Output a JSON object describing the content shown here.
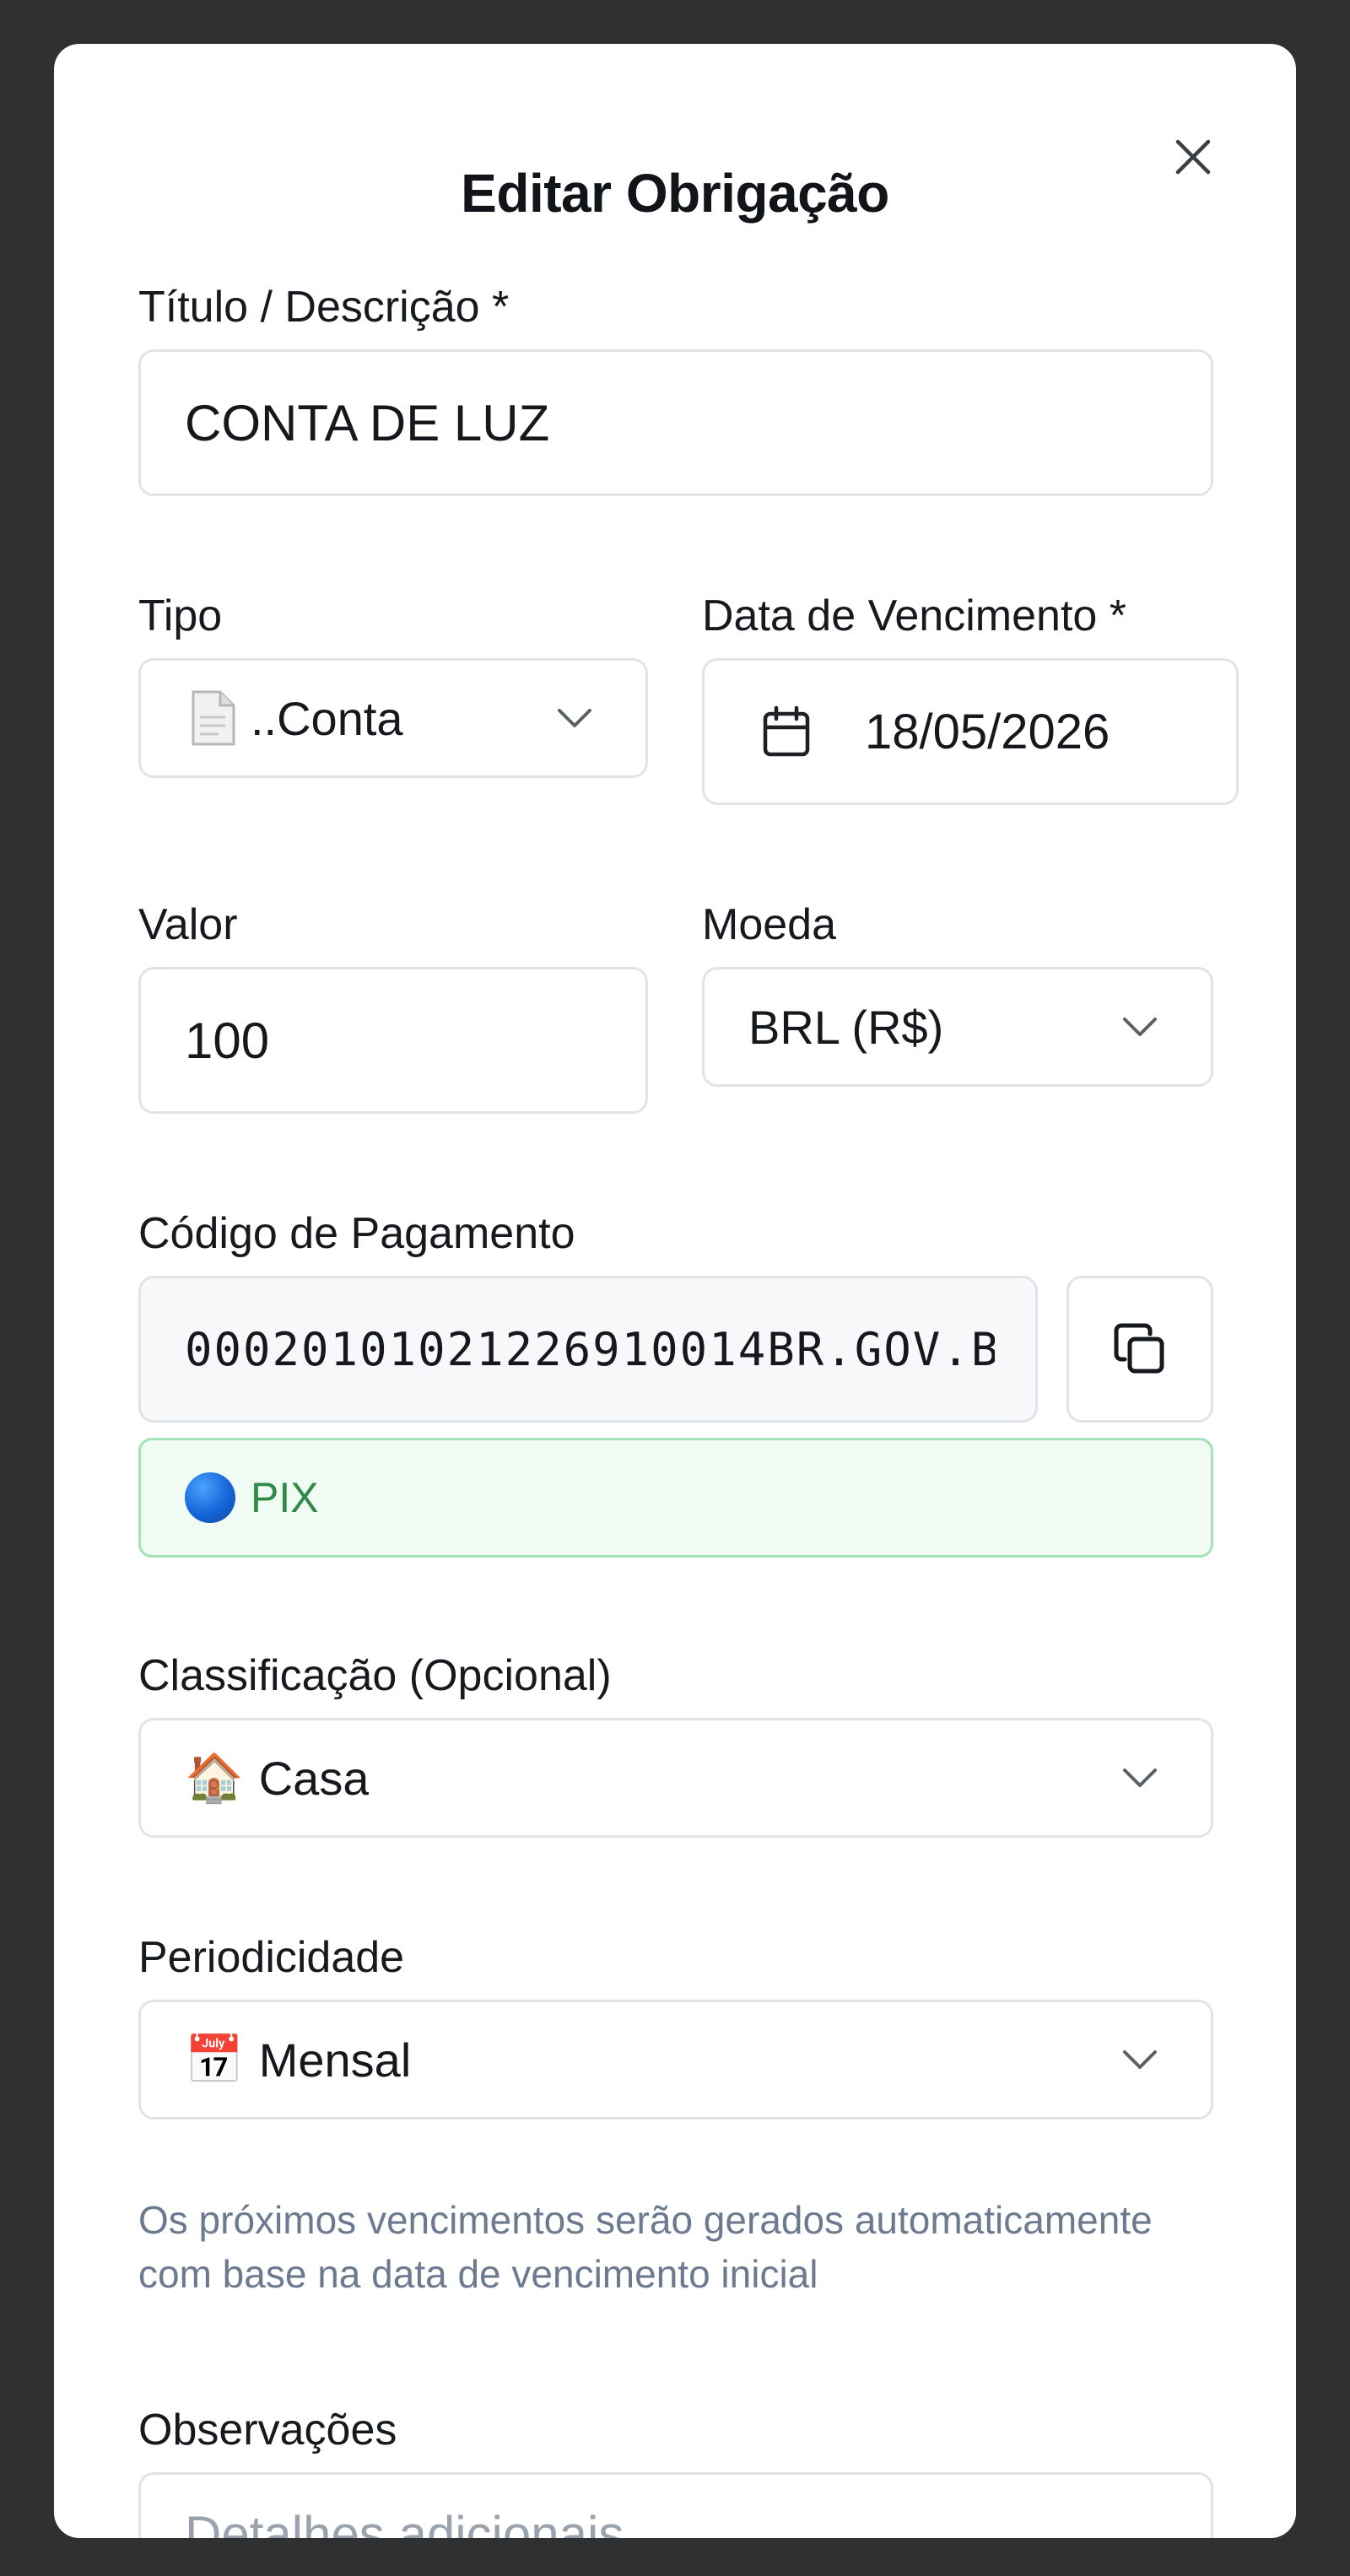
{
  "modal": {
    "title": "Editar Obrigação",
    "close_icon": "close-icon"
  },
  "form": {
    "titulo": {
      "label": "Título / Descrição *",
      "value": "CONTA DE LUZ"
    },
    "tipo": {
      "label": "Tipo",
      "icon": "document-icon",
      "value": "..Conta"
    },
    "vencimento": {
      "label": "Data de Vencimento *",
      "icon": "calendar-icon",
      "value": "18/05/2026"
    },
    "valor": {
      "label": "Valor",
      "value": "100"
    },
    "moeda": {
      "label": "Moeda",
      "value": "BRL (R$)"
    },
    "codigo": {
      "label": "Código de Pagamento",
      "value": "00020101021226910014BR.GOV.B",
      "copy_icon": "copy-icon",
      "badge": {
        "icon": "blue-circle-icon",
        "text": "PIX"
      }
    },
    "classificacao": {
      "label": "Classificação (Opcional)",
      "emoji": "🏠",
      "value": "Casa"
    },
    "periodicidade": {
      "label": "Periodicidade",
      "emoji": "📅",
      "value": "Mensal",
      "hint": "Os próximos vencimentos serão gerados automaticamente com base na data de vencimento inicial"
    },
    "observacoes": {
      "label": "Observações",
      "placeholder": "Detalhes adicionais..."
    }
  },
  "colors": {
    "backdrop": "#2e3032",
    "modal_bg": "#ffffff",
    "border": "#e0e3e8",
    "hint_text": "#6c7a90",
    "pix_text": "#2e8b47",
    "pix_bg": "#f0fbf3",
    "pix_border": "#a6e3b4"
  }
}
